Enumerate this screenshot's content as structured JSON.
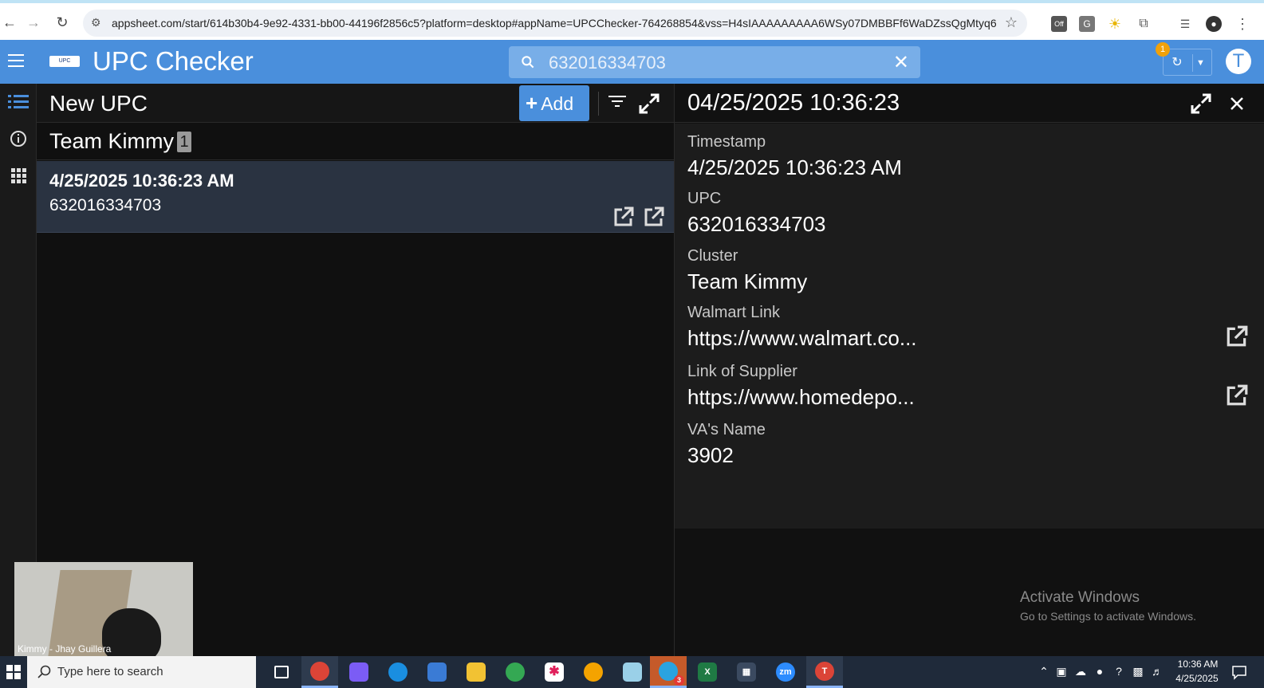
{
  "browser": {
    "url": "appsheet.com/start/614b30b4-9e92-4331-bb00-44196f2856c5?platform=desktop#appName=UPCChecker-764268854&vss=H4sIAAAAAAAAA6WSy07DMBBFf6WaDZssQgMtyq6k...",
    "extension_badge": "Off"
  },
  "app": {
    "title": "UPC Checker",
    "logo_text": "UPC",
    "search_value": "632016334703",
    "sync_badge": "1",
    "avatar_letter": "T"
  },
  "list": {
    "title": "New UPC",
    "add_label": "Add",
    "group_title": "Team Kimmy",
    "group_count": "1",
    "rows": [
      {
        "primary": "4/25/2025 10:36:23 AM",
        "secondary": "632016334703"
      }
    ]
  },
  "detail": {
    "title": "04/25/2025 10:36:23",
    "fields": [
      {
        "label": "Timestamp",
        "value": "4/25/2025 10:36:23 AM"
      },
      {
        "label": "UPC",
        "value": "632016334703"
      },
      {
        "label": "Cluster",
        "value": "Team Kimmy"
      },
      {
        "label": "Walmart Link",
        "value": "https://www.walmart.co..."
      },
      {
        "label": "Link of Supplier",
        "value": "https://www.homedepo..."
      },
      {
        "label": "VA's Name",
        "value": "3902"
      }
    ]
  },
  "watermark": {
    "line1": "Activate Windows",
    "line2": "Go to Settings to activate Windows."
  },
  "video": {
    "caption": "Kimmy - Jhay Guillera"
  },
  "taskbar": {
    "search_placeholder": "Type here to search",
    "telegram_badge": "3",
    "zoom_label": "zm",
    "chrome_profile_letter": "T",
    "time": "10:36 AM",
    "date": "4/25/2025"
  },
  "colors": {
    "accent": "#4a8fdc",
    "row_selected": "#2a3341",
    "panel_bg": "#1c1c1c"
  }
}
